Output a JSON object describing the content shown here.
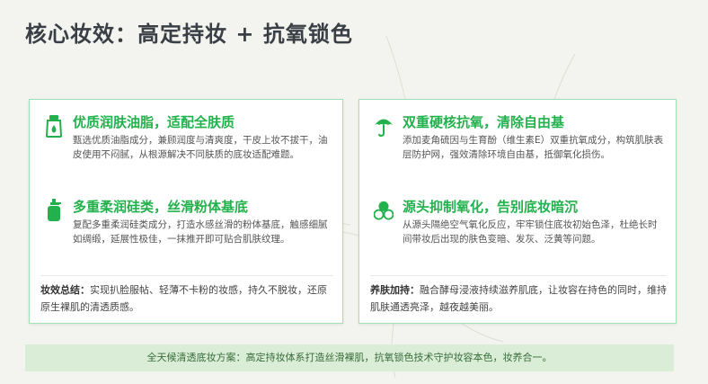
{
  "title": "核心妆效：高定持妆 + 抗氧锁色",
  "left_card": {
    "items": [
      {
        "icon": "lotion-tube-icon",
        "heading": "优质润肤油脂，适配全肤质",
        "description": "甄选优质油脂成分，兼顾润度与清爽度，干皮上妆不拔干，油皮使用不闷腻，从根源解决不同肤质的底妆适配难题。"
      },
      {
        "icon": "pump-bottle-icon",
        "heading": "多重柔润硅类，丝滑粉体基底",
        "description": "复配多重柔润硅类成分，打造水感丝滑的粉体基底，触感细腻如绸缎，延展性极佳，一抹推开即可贴合肌肤纹理。"
      }
    ],
    "summary_label": "妆效总结：",
    "summary_text": "实现扒脸服帖、轻薄不卡粉的妆感，持久不脱妆，还原原生裸肌的清透质感。"
  },
  "right_card": {
    "items": [
      {
        "icon": "umbrella-icon",
        "heading": "双重硬核抗氧，清除自由基",
        "description": "添加麦角硫因与生育酚（维生素E）双重抗氧成分，构筑肌肤表层防护网，强效清除环境自由基，抵御氧化损伤。"
      },
      {
        "icon": "molecule-cluster-icon",
        "heading": "源头抑制氧化，告别底妆暗沉",
        "description": "从源头隔绝空气氧化反应，牢牢锁住底妆初始色泽，杜绝长时间带妆后出现的肤色变暗、发灰、泛黄等问题。"
      }
    ],
    "summary_label": "养肤加持：",
    "summary_text": "融合酵母浸液持续滋养肌底，让妆容在持色的同时，维持肌肤通透亮泽，越夜越美丽。"
  },
  "banner": "全天候清透底妆方案：高定持妆体系打造丝滑裸肌，抗氧锁色技术守护妆容本色，妆养合一。",
  "colors": {
    "accent_green": "#22b14c",
    "card_border": "#9fe0b4",
    "banner_bg": "#d9edd7",
    "background": "#f3f3ef"
  }
}
